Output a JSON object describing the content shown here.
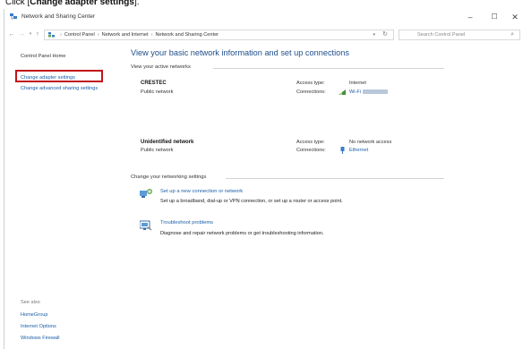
{
  "caption": {
    "prefix": "Click [",
    "bold": "Change adapter settings",
    "suffix": "]."
  },
  "window": {
    "title": "Network and Sharing Center",
    "minimize": "–",
    "maximize": "☐",
    "close": "✕"
  },
  "address_bar": {
    "crumbs": [
      "Control Panel",
      "Network and Internet",
      "Network and Sharing Center"
    ],
    "search_placeholder": "Search Control Panel"
  },
  "left_pane": {
    "home": "Control Panel Home",
    "change_adapter": "Change adapter settings",
    "change_sharing": "Change advanced sharing settings",
    "see_also_label": "See also",
    "see_also": [
      "HomeGroup",
      "Internet Options",
      "Windows Firewall"
    ]
  },
  "main": {
    "title": "View your basic network information and set up connections",
    "active_networks_label": "View your active networks",
    "networks": [
      {
        "name": "CRESTEC",
        "category": "Public network",
        "access_type_label": "Access type:",
        "access_type": "Internet",
        "connections_label": "Connections:",
        "connection": "Wi-Fi",
        "connection_icon": "wifi-icon"
      },
      {
        "name": "Unidentified network",
        "category": "Public network",
        "access_type_label": "Access type:",
        "access_type": "No network access",
        "connections_label": "Connections:",
        "connection": "Ethernet",
        "connection_icon": "ethernet-icon"
      }
    ],
    "change_settings_label": "Change your networking settings",
    "tasks": [
      {
        "link": "Set up a new connection or network",
        "desc": "Set up a broadband, dial-up or VPN connection, or set up a router or access point.",
        "icon": "new-connection-icon"
      },
      {
        "link": "Troubleshoot problems",
        "desc": "Diagnose and repair network problems or get troubleshooting information.",
        "icon": "troubleshoot-icon"
      }
    ]
  },
  "colors": {
    "link": "#1a5ea8",
    "title": "#1e4e8c",
    "highlight": "#c0141a"
  }
}
